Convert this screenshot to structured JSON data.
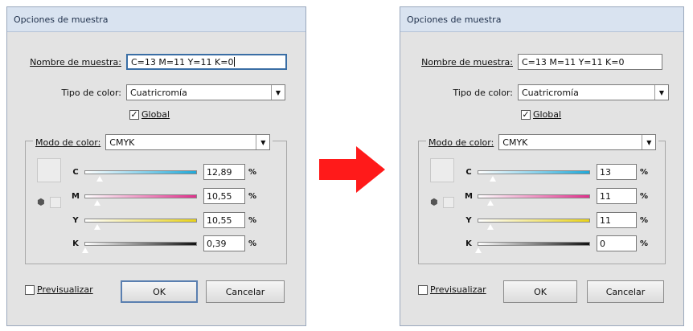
{
  "dialogs": [
    {
      "title": "Opciones de muestra",
      "name_label": "Nombre de muestra:",
      "name_value": "C=13 M=11 Y=11 K=0",
      "type_label": "Tipo de color:",
      "type_value": "Cuatricromía",
      "global_label": "Global",
      "mode_label": "Modo de color:",
      "mode_value": "CMYK",
      "channels": [
        {
          "label": "C",
          "value": "12,89",
          "level": 0.13
        },
        {
          "label": "M",
          "value": "10,55",
          "level": 0.11
        },
        {
          "label": "Y",
          "value": "10,55",
          "level": 0.11
        },
        {
          "label": "K",
          "value": "0,39",
          "level": 0.0
        }
      ],
      "percent": "%",
      "preview_label": "Previsualizar",
      "ok_label": "OK",
      "cancel_label": "Cancelar"
    },
    {
      "title": "Opciones de muestra",
      "name_label": "Nombre de muestra:",
      "name_value": "C=13 M=11 Y=11 K=0",
      "type_label": "Tipo de color:",
      "type_value": "Cuatricromía",
      "global_label": "Global",
      "mode_label": "Modo de color:",
      "mode_value": "CMYK",
      "channels": [
        {
          "label": "C",
          "value": "13",
          "level": 0.13
        },
        {
          "label": "M",
          "value": "11",
          "level": 0.11
        },
        {
          "label": "Y",
          "value": "11",
          "level": 0.11
        },
        {
          "label": "K",
          "value": "0",
          "level": 0.0
        }
      ],
      "percent": "%",
      "preview_label": "Previsualizar",
      "ok_label": "OK",
      "cancel_label": "Cancelar"
    }
  ],
  "colors": {
    "cyan_track": "#1fa8d8",
    "magenta_track": "#e0308c",
    "yellow_track": "#e8d21a",
    "black_track": "#111111",
    "arrow": "#ff1a1a"
  }
}
